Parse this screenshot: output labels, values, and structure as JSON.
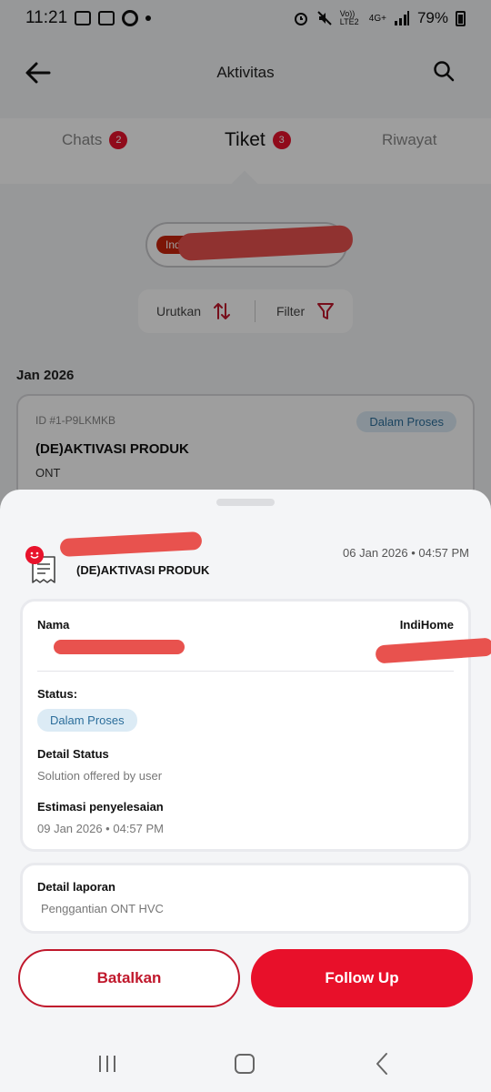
{
  "status_bar": {
    "time": "11:21",
    "battery": "79%",
    "network": "4G+",
    "volte": "Vo)) LTE2"
  },
  "header": {
    "title": "Aktivitas"
  },
  "tabs": [
    {
      "label": "Chats",
      "count": "2"
    },
    {
      "label": "Tiket",
      "count": "3"
    },
    {
      "label": "Riwayat"
    }
  ],
  "product_chip": {
    "label": "IndiHome"
  },
  "sort_filter": {
    "sort_label": "Urutkan",
    "filter_label": "Filter"
  },
  "list": {
    "month": "Jan 2026",
    "ticket": {
      "id": "ID #1-P9LKMKB",
      "status": "Dalam Proses",
      "title": "(DE)AKTIVASI PRODUK",
      "device": "ONT"
    }
  },
  "sheet": {
    "date": "06 Jan 2026 • 04:57 PM",
    "title": "(DE)AKTIVASI PRODUK",
    "nama_label": "Nama",
    "product_label": "IndiHome",
    "status_label": "Status:",
    "status_value": "Dalam Proses",
    "detail_status_label": "Detail Status",
    "detail_status_value": "Solution offered by user",
    "estimasi_label": "Estimasi penyelesaian",
    "estimasi_value": "09 Jan 2026 • 04:57 PM",
    "detail_laporan_label": "Detail laporan",
    "detail_laporan_value": "Penggantian ONT HVC",
    "cancel_label": "Batalkan",
    "follow_up_label": "Follow Up"
  },
  "colors": {
    "accent": "#e8102a",
    "status_bg": "#dcebf5",
    "status_text": "#2c6e9b",
    "redaction": "#e8524e"
  }
}
